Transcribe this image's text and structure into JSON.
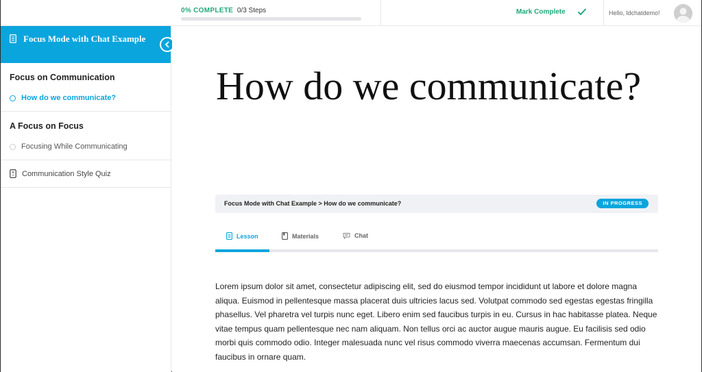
{
  "topbar": {
    "progress_percent_label": "0% COMPLETE",
    "progress_steps_label": "0/3 Steps",
    "progress_value": 0,
    "mark_complete_label": "Mark Complete",
    "greeting": "Hello, ldchatdemo!",
    "accent_color": "#20a97a"
  },
  "sidebar": {
    "course_title": "Focus Mode with Chat Example",
    "sections": [
      {
        "title": "Focus on Communication",
        "lesson": "How do we communicate?"
      },
      {
        "title": "A Focus on Focus",
        "lesson": "Focusing While Communicating"
      }
    ],
    "quiz_label": "Communication Style Quiz",
    "header_color": "#0aa5dd"
  },
  "main": {
    "title": "How do we communicate?",
    "breadcrumb": "Focus Mode with Chat Example > How do we communicate?",
    "status": "IN PROGRESS",
    "tabs": [
      {
        "label": "Lesson",
        "icon": "document-icon"
      },
      {
        "label": "Materials",
        "icon": "book-icon"
      },
      {
        "label": "Chat",
        "icon": "chat-bubble-icon"
      }
    ],
    "body": "Lorem ipsum dolor sit amet, consectetur adipiscing elit, sed do eiusmod tempor incididunt ut labore et dolore magna aliqua. Euismod in pellentesque massa placerat duis ultricies lacus sed. Volutpat commodo sed egestas egestas fringilla phasellus. Vel pharetra vel turpis nunc eget. Libero enim sed faucibus turpis in eu. Cursus in hac habitasse platea. Neque vitae tempus quam pellentesque nec nam aliquam. Non tellus orci ac auctor augue mauris augue. Eu facilisis sed odio morbi quis commodo odio. Integer malesuada nunc vel risus commodo viverra maecenas accumsan. Fermentum dui faucibus in ornare quam."
  }
}
